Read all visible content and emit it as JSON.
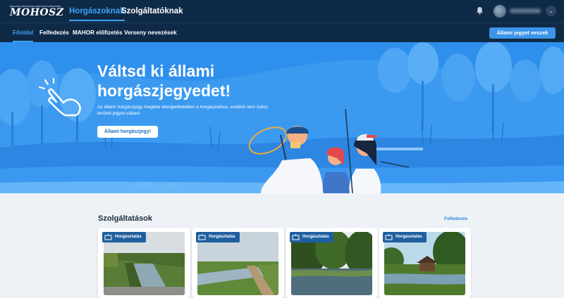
{
  "header": {
    "logo_text": "MOHOSZ",
    "logo_subtitle": "MAGYAR ORSZÁGOS HORGÁSZ SZÖVETSÉG",
    "tabs": [
      {
        "label": "Horgászoknak",
        "active": true
      },
      {
        "label": "Szolgáltatóknak",
        "active": false
      }
    ],
    "icons": [
      "bell-icon",
      "avatar",
      "chevron-down-icon"
    ]
  },
  "subnav": {
    "items": [
      {
        "label": "Főoldal",
        "active": true
      },
      {
        "label": "Felfedezés",
        "active": false
      },
      {
        "label": "MAHOR előfizetés",
        "active": false
      },
      {
        "label": "Verseny nevezések",
        "active": false
      }
    ],
    "cta_label": "Állami jegyet veszek"
  },
  "hero": {
    "title": "Váltsd ki állami horgászjegyedet!",
    "text": "Az állami horgászjegy megléte elengedhetetlen a horgászathoz, enélkül nem tudsz területi jegyet váltani.",
    "button_label": "Állami horgászjegy!"
  },
  "services": {
    "title": "Szolgáltatások",
    "link_label": "Felfedezés",
    "cards": [
      {
        "badge": "Horgásztatás",
        "scene": "canal"
      },
      {
        "badge": "Horgásztatás",
        "scene": "dike"
      },
      {
        "badge": "Horgásztatás",
        "scene": "lake-trees"
      },
      {
        "badge": "Horgásztatás",
        "scene": "pier"
      }
    ]
  },
  "colors": {
    "navbar": "#0f2a47",
    "accent": "#3da5f5",
    "hero": "#2f8fec",
    "button": "#3c95e8",
    "badge": "#1f5f9f"
  }
}
